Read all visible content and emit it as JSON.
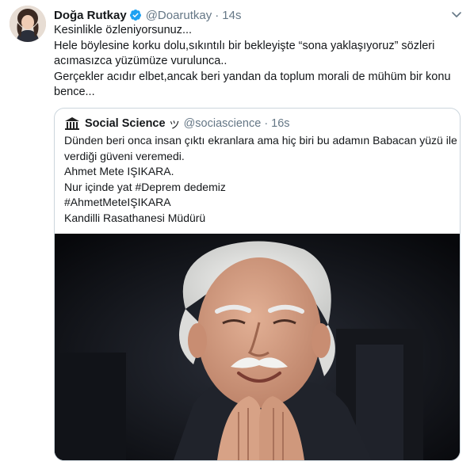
{
  "tweet": {
    "author_name": "Doğa Rutkay",
    "author_handle": "@Doarutkay",
    "separator": "·",
    "time": "14s",
    "verified_icon": "verified-badge-icon",
    "menu_icon": "chevron-down-icon",
    "text_lines": [
      "Kesinlikle özleniyorsunuz...",
      "Hele böylesine korku dolu,sıkıntılı bir bekleyişte “sona yaklaşıyoruz” sözleri",
      "acımasızca yüzümüze vurulunca..",
      "Gerçekler acıdır elbet,ancak beri yandan da toplum morali de mühüm bir konu",
      "bence..."
    ]
  },
  "quoted_tweet": {
    "author_name": "Social Science",
    "name_glyph": "ツ",
    "author_handle": "@sociascience",
    "separator": "·",
    "time": "16s",
    "text_lines": [
      "Dünden beri onca insan çıktı ekranlara ama hiç biri bu adamın Babacan yüzü ile",
      "verdiği güveni veremedi.",
      "Ahmet Mete IŞIKARA.",
      "Nur içinde yat #Deprem dedemiz",
      "#AhmetMeteIŞIKARA",
      "Kandilli Rasathanesi Müdürü"
    ],
    "media_icon": "photo-elderly-man-smiling"
  },
  "colors": {
    "text_primary": "#14171a",
    "text_secondary": "#657786",
    "border": "#ccd6dd",
    "verified_blue": "#1da1f2"
  }
}
